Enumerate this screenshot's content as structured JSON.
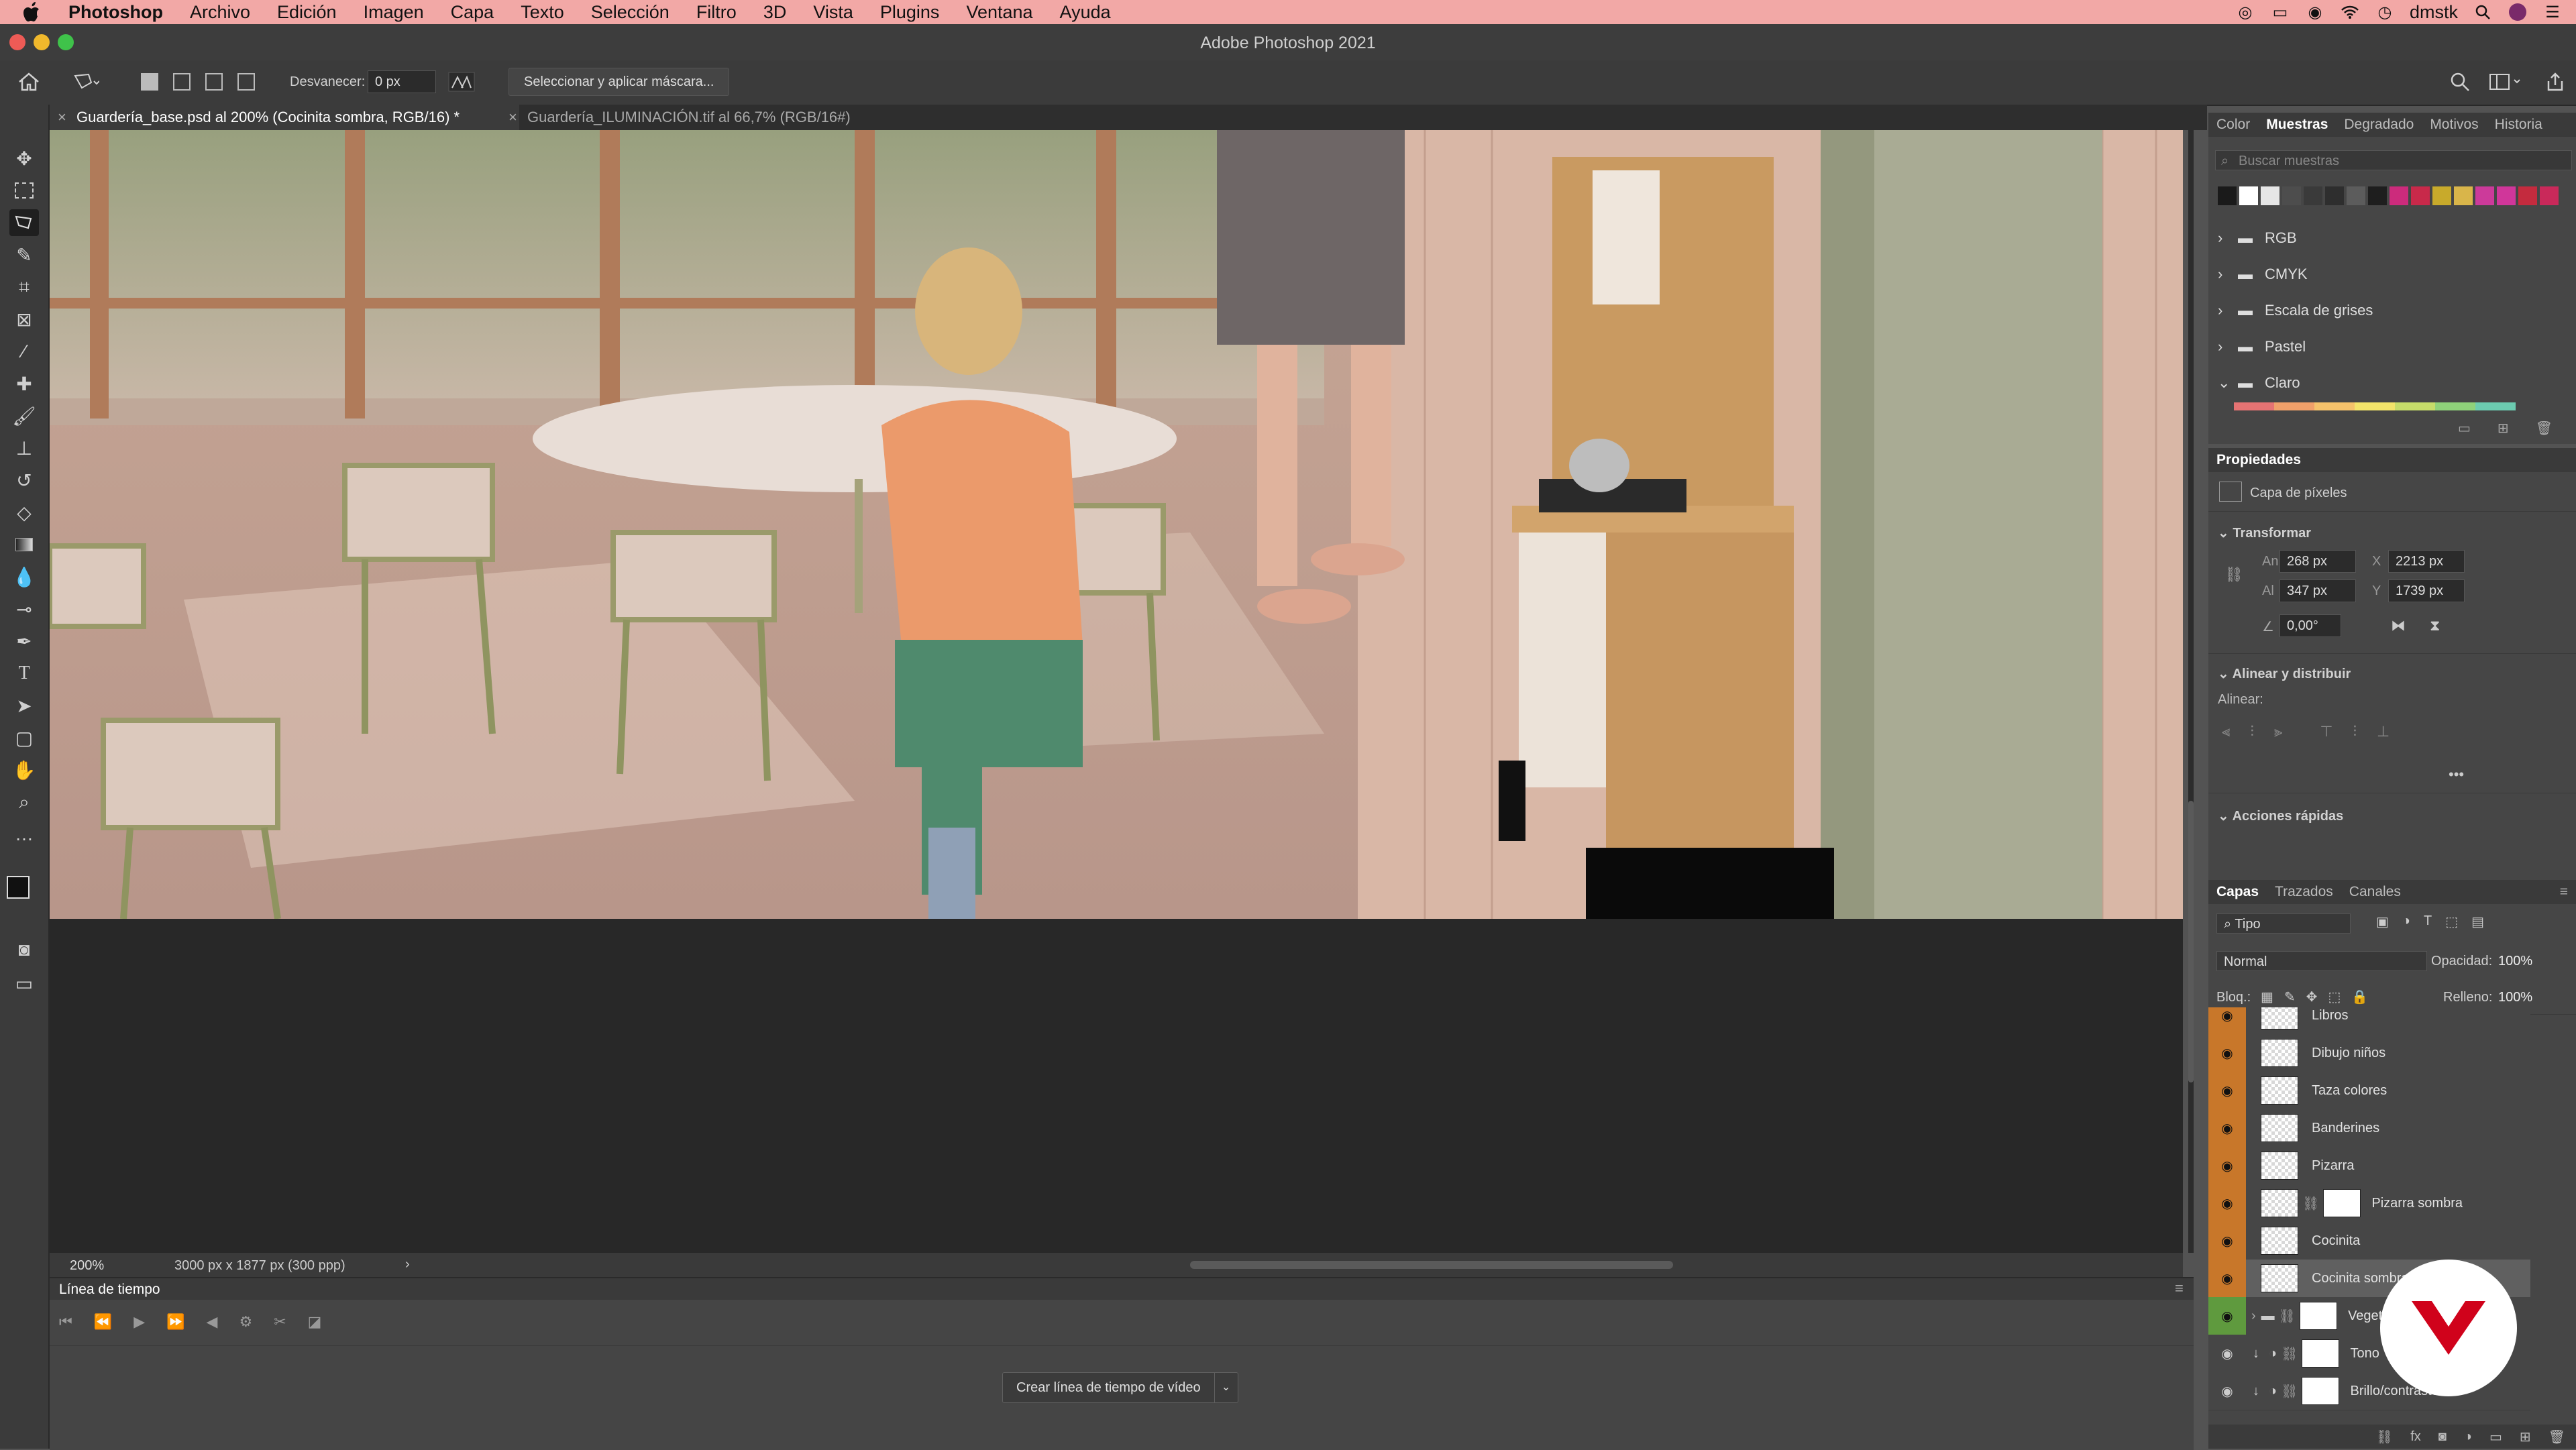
{
  "menubar": {
    "app": "Photoshop",
    "items": [
      "Archivo",
      "Edición",
      "Imagen",
      "Capa",
      "Texto",
      "Selección",
      "Filtro",
      "3D",
      "Vista",
      "Plugins",
      "Ventana",
      "Ayuda"
    ],
    "user": "dmstk"
  },
  "window": {
    "title": "Adobe Photoshop 2021"
  },
  "options": {
    "feather_label": "Desvanecer:",
    "feather_value": "0 px",
    "mask_button": "Seleccionar y aplicar máscara..."
  },
  "tabs": [
    {
      "label": "Guardería_base.psd al 200% (Cocinita sombra, RGB/16) *",
      "active": true
    },
    {
      "label": "Guardería_ILUMINACIÓN.tif al 66,7% (RGB/16#)",
      "active": false
    }
  ],
  "status": {
    "zoom": "200%",
    "doc_info": "3000 px x 1877 px (300 ppp)"
  },
  "timeline": {
    "title": "Línea de tiempo",
    "create_button": "Crear línea de tiempo de vídeo"
  },
  "swatches_panel": {
    "tabs": [
      "Color",
      "Muestras",
      "Degradado",
      "Motivos",
      "Historia"
    ],
    "active_tab": "Muestras",
    "search_placeholder": "Buscar muestras",
    "folders": [
      "RGB",
      "CMYK",
      "Escala de grises",
      "Pastel",
      "Claro"
    ],
    "colors": [
      "#1a1a1a",
      "#ffffff",
      "#e6e6e6",
      "#4d4d4d",
      "#3a3a3a",
      "#2e2e2e",
      "#5c5c5c",
      "#1e1e1e",
      "#cc2b7c",
      "#c8294a",
      "#c8aa2b",
      "#d9b54a",
      "#cc3a9a",
      "#d0369a",
      "#c42b3e",
      "#c9295a"
    ],
    "claro_colors": [
      "#e57373",
      "#f0a06a",
      "#f5c26b",
      "#f3e46a",
      "#c6dc6a",
      "#8fd17a",
      "#6ccbb0"
    ]
  },
  "properties_panel": {
    "title": "Propiedades",
    "layer_type": "Capa de píxeles",
    "transform_title": "Transformar",
    "w_label": "An",
    "w_value": "268 px",
    "x_label": "X",
    "x_value": "2213 px",
    "h_label": "Al",
    "h_value": "347 px",
    "y_label": "Y",
    "y_value": "1739 px",
    "angle_value": "0,00°",
    "align_title": "Alinear y distribuir",
    "align_label": "Alinear:",
    "quick_title": "Acciones rápidas"
  },
  "layers_panel": {
    "tabs": [
      "Capas",
      "Trazados",
      "Canales"
    ],
    "active_tab": "Capas",
    "filter": "Tipo",
    "blend": "Normal",
    "opacity_label": "Opacidad:",
    "opacity": "100%",
    "lock_label": "Bloq.:",
    "fill_label": "Relleno:",
    "fill": "100%",
    "layers": [
      {
        "name": "Libros",
        "color": "orange"
      },
      {
        "name": "Dibujo niños",
        "color": "orange"
      },
      {
        "name": "Taza colores",
        "color": "orange"
      },
      {
        "name": "Banderines",
        "color": "orange"
      },
      {
        "name": "Pizarra",
        "color": "orange"
      },
      {
        "name": "Pizarra sombra",
        "color": "orange"
      },
      {
        "name": "Cocinita",
        "color": "orange"
      },
      {
        "name": "Cocinita sombra",
        "color": "orange"
      },
      {
        "name": "Vegetación",
        "color": "green"
      },
      {
        "name": "Tono",
        "color": "none"
      },
      {
        "name": "Brillo/contraste 1",
        "color": "none"
      }
    ]
  },
  "colors": {
    "layer_orange": "#c8772a",
    "layer_green": "#5f9a3e",
    "menubar_bg": "#f2a8a6",
    "brand_red": "#d0021b"
  }
}
